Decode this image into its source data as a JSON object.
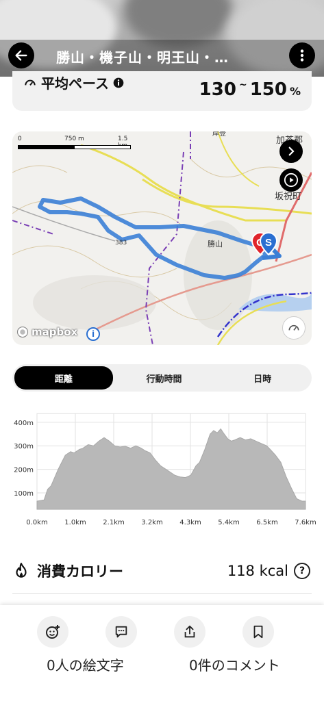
{
  "header": {
    "title": "勝山・機子山・明王山・…",
    "back_icon": "arrow-left-icon",
    "more_icon": "more-vertical-icon"
  },
  "pace": {
    "label": "平均ペース",
    "low": "130",
    "separator": "~",
    "high": "150",
    "unit": "%"
  },
  "map": {
    "scale_labels": [
      "0",
      "750 m",
      "1.5 km"
    ],
    "place_labels": {
      "katsuyama": "勝山",
      "kasai": "加茶郡",
      "sakahogi": "坂祝町",
      "peak": "383",
      "road": "岸登"
    },
    "attribution": "mapbox",
    "info_glyph": "i",
    "markers": {
      "goal": "G",
      "start": "S"
    },
    "colors": {
      "route": "#3b7fd6",
      "goal": "#e0242b",
      "start": "#2a6fd1",
      "river": "#3333cc"
    }
  },
  "tabs": {
    "items": [
      "距離",
      "行動時間",
      "日時"
    ],
    "active": 0
  },
  "chart_data": {
    "type": "area",
    "title": "",
    "xlabel": "",
    "ylabel": "",
    "x_ticks": [
      "0.0km",
      "1.0km",
      "2.1km",
      "3.2km",
      "4.3km",
      "5.4km",
      "6.5km",
      "7.6km"
    ],
    "y_ticks": [
      "100m",
      "200m",
      "300m",
      "400m"
    ],
    "xlim": [
      0,
      7.6
    ],
    "ylim": [
      30,
      420
    ],
    "x": [
      0,
      0.2,
      0.3,
      0.4,
      0.6,
      0.8,
      0.95,
      1.05,
      1.2,
      1.3,
      1.45,
      1.6,
      1.75,
      1.9,
      2.05,
      2.2,
      2.35,
      2.5,
      2.65,
      2.8,
      2.95,
      3.05,
      3.2,
      3.35,
      3.5,
      3.65,
      3.8,
      3.9,
      4.05,
      4.2,
      4.35,
      4.5,
      4.6,
      4.75,
      4.9,
      5.0,
      5.1,
      5.2,
      5.3,
      5.4,
      5.5,
      5.6,
      5.75,
      5.9,
      6.05,
      6.2,
      6.35,
      6.5,
      6.6,
      6.75,
      6.9,
      7.05,
      7.2,
      7.35,
      7.5,
      7.6
    ],
    "y": [
      65,
      70,
      115,
      130,
      200,
      260,
      275,
      270,
      285,
      290,
      305,
      300,
      320,
      335,
      320,
      300,
      295,
      298,
      290,
      300,
      290,
      280,
      270,
      240,
      215,
      200,
      185,
      175,
      168,
      165,
      175,
      215,
      230,
      285,
      350,
      365,
      355,
      372,
      350,
      330,
      320,
      325,
      335,
      325,
      330,
      320,
      310,
      300,
      285,
      260,
      230,
      170,
      120,
      75,
      65,
      65
    ],
    "color": "#b8b8b8"
  },
  "calories": {
    "label": "消費カロリー",
    "value": "118 kcal",
    "help_glyph": "?"
  },
  "bottom": {
    "emoji_count": "0人の絵文字",
    "comment_count": "0件のコメント"
  }
}
